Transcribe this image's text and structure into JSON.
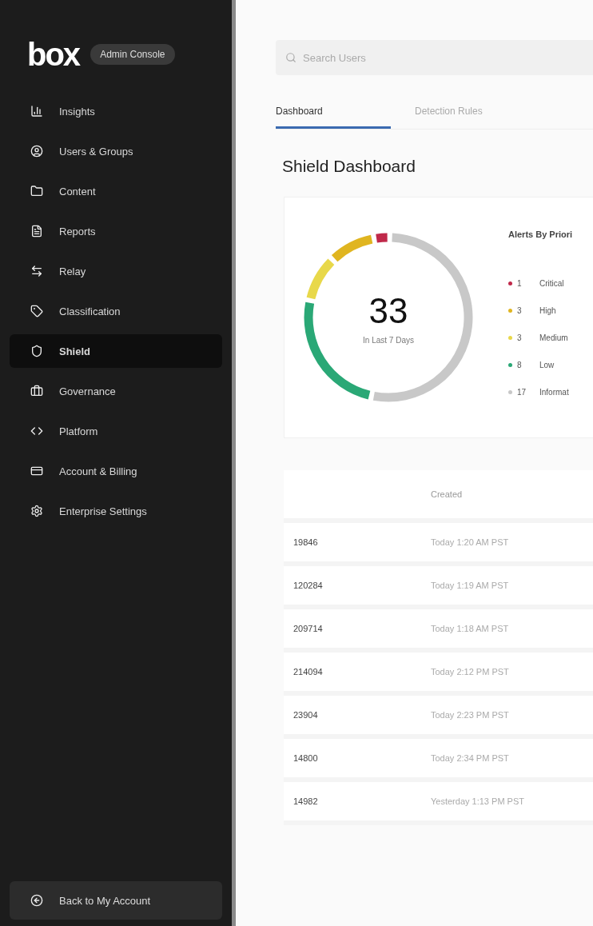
{
  "sidebar": {
    "logo": "box",
    "badge": "Admin Console",
    "items": [
      {
        "label": "Insights",
        "selected": false
      },
      {
        "label": "Users & Groups",
        "selected": false
      },
      {
        "label": "Content",
        "selected": false
      },
      {
        "label": "Reports",
        "selected": false
      },
      {
        "label": "Relay",
        "selected": false
      },
      {
        "label": "Classification",
        "selected": false
      },
      {
        "label": "Shield",
        "selected": true
      },
      {
        "label": "Governance",
        "selected": false
      },
      {
        "label": "Platform",
        "selected": false
      },
      {
        "label": "Account & Billing",
        "selected": false
      },
      {
        "label": "Enterprise Settings",
        "selected": false
      }
    ],
    "back_button": "Back to My Account"
  },
  "search": {
    "placeholder": "Search Users"
  },
  "tabs": [
    {
      "label": "Dashboard",
      "selected": true
    },
    {
      "label": "Detection Rules",
      "selected": false
    }
  ],
  "title": "Shield Dashboard",
  "summary": {
    "total": "33",
    "caption": "In Last 7 Days",
    "legend_title": "Alerts By Priori",
    "legend": [
      {
        "count": "1",
        "label": "Critical",
        "color": "#c0294a"
      },
      {
        "count": "3",
        "label": "High",
        "color": "#e0b520"
      },
      {
        "count": "3",
        "label": "Medium",
        "color": "#e8d84a"
      },
      {
        "count": "8",
        "label": "Low",
        "color": "#2aa876"
      },
      {
        "count": "17",
        "label": "Informat",
        "color": "#c8c8c8"
      }
    ]
  },
  "table": {
    "columns": [
      "Created"
    ],
    "rows": [
      {
        "id": "19846",
        "created": "Today 1:20 AM PST"
      },
      {
        "id": "120284",
        "created": "Today 1:19 AM PST"
      },
      {
        "id": "209714",
        "created": "Today 1:18 AM PST"
      },
      {
        "id": "214094",
        "created": "Today 2:12 PM PST"
      },
      {
        "id": "23904",
        "created": "Today 2:23 PM PST"
      },
      {
        "id": "14800",
        "created": "Today 2:34 PM PST"
      },
      {
        "id": "14982",
        "created": "Yesterday 1:13 PM PST"
      }
    ]
  }
}
